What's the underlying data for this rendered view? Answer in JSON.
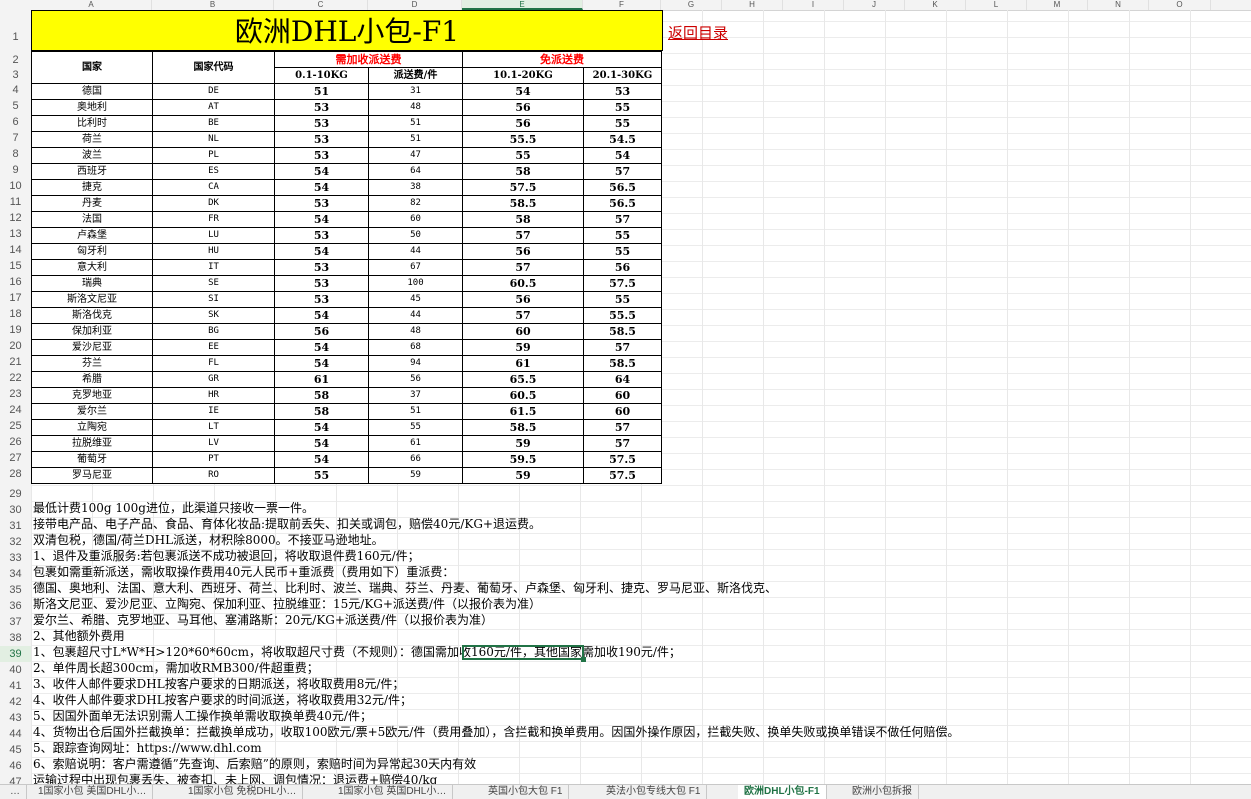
{
  "title": "欧洲DHL小包-F1",
  "back_link": "返回目录",
  "columns": [
    "A",
    "B",
    "C",
    "D",
    "E",
    "F",
    "G",
    "H",
    "I",
    "J",
    "K",
    "L",
    "M",
    "N",
    "O"
  ],
  "selected_column": "E",
  "selected_row": "39",
  "headers": {
    "country": "国家",
    "code": "国家代码",
    "group_extra": "需加收派送费",
    "group_free": "免派送费",
    "w1": "0.1-10KG",
    "w1fee": "派送费/件",
    "w2": "10.1-20KG",
    "w3": "20.1-30KG"
  },
  "rows": [
    {
      "country": "德国",
      "code": "DE",
      "w1": "51",
      "fee": "31",
      "w2": "54",
      "w3": "53"
    },
    {
      "country": "奥地利",
      "code": "AT",
      "w1": "53",
      "fee": "48",
      "w2": "56",
      "w3": "55"
    },
    {
      "country": "比利时",
      "code": "BE",
      "w1": "53",
      "fee": "51",
      "w2": "56",
      "w3": "55"
    },
    {
      "country": "荷兰",
      "code": "NL",
      "w1": "53",
      "fee": "51",
      "w2": "55.5",
      "w3": "54.5"
    },
    {
      "country": "波兰",
      "code": "PL",
      "w1": "53",
      "fee": "47",
      "w2": "55",
      "w3": "54"
    },
    {
      "country": "西班牙",
      "code": "ES",
      "w1": "54",
      "fee": "64",
      "w2": "58",
      "w3": "57"
    },
    {
      "country": "捷克",
      "code": "CA",
      "w1": "54",
      "fee": "38",
      "w2": "57.5",
      "w3": "56.5"
    },
    {
      "country": "丹麦",
      "code": "DK",
      "w1": "53",
      "fee": "82",
      "w2": "58.5",
      "w3": "56.5"
    },
    {
      "country": "法国",
      "code": "FR",
      "w1": "54",
      "fee": "60",
      "w2": "58",
      "w3": "57"
    },
    {
      "country": "卢森堡",
      "code": "LU",
      "w1": "53",
      "fee": "50",
      "w2": "57",
      "w3": "55"
    },
    {
      "country": "匈牙利",
      "code": "HU",
      "w1": "54",
      "fee": "44",
      "w2": "56",
      "w3": "55"
    },
    {
      "country": "意大利",
      "code": "IT",
      "w1": "53",
      "fee": "67",
      "w2": "57",
      "w3": "56"
    },
    {
      "country": "瑞典",
      "code": "SE",
      "w1": "53",
      "fee": "100",
      "w2": "60.5",
      "w3": "57.5"
    },
    {
      "country": "斯洛文尼亚",
      "code": "SI",
      "w1": "53",
      "fee": "45",
      "w2": "56",
      "w3": "55"
    },
    {
      "country": "斯洛伐克",
      "code": "SK",
      "w1": "54",
      "fee": "44",
      "w2": "57",
      "w3": "55.5"
    },
    {
      "country": "保加利亚",
      "code": "BG",
      "w1": "56",
      "fee": "48",
      "w2": "60",
      "w3": "58.5"
    },
    {
      "country": "爱沙尼亚",
      "code": "EE",
      "w1": "54",
      "fee": "68",
      "w2": "59",
      "w3": "57"
    },
    {
      "country": "芬兰",
      "code": "FL",
      "w1": "54",
      "fee": "94",
      "w2": "61",
      "w3": "58.5"
    },
    {
      "country": "希腊",
      "code": "GR",
      "w1": "61",
      "fee": "56",
      "w2": "65.5",
      "w3": "64"
    },
    {
      "country": "克罗地亚",
      "code": "HR",
      "w1": "58",
      "fee": "37",
      "w2": "60.5",
      "w3": "60"
    },
    {
      "country": "爱尔兰",
      "code": "IE",
      "w1": "58",
      "fee": "51",
      "w2": "61.5",
      "w3": "60"
    },
    {
      "country": "立陶宛",
      "code": "LT",
      "w1": "54",
      "fee": "55",
      "w2": "58.5",
      "w3": "57"
    },
    {
      "country": "拉脱维亚",
      "code": "LV",
      "w1": "54",
      "fee": "61",
      "w2": "59",
      "w3": "57"
    },
    {
      "country": "葡萄牙",
      "code": "PT",
      "w1": "54",
      "fee": "66",
      "w2": "59.5",
      "w3": "57.5"
    },
    {
      "country": "罗马尼亚",
      "code": "RO",
      "w1": "55",
      "fee": "59",
      "w2": "59",
      "w3": "57.5"
    }
  ],
  "notes": [
    {
      "row": "30",
      "text": "最低计费100g 100g进位，此渠道只接收一票一件。"
    },
    {
      "row": "31",
      "text": "接带电产品、电子产品、食品、育体化妆品:提取前丢失、扣关或调包，赔偿40元/KG+退运费。"
    },
    {
      "row": "32",
      "text": "双清包税，德国/荷兰DHL派送，材积除8000。不接亚马逊地址。"
    },
    {
      "row": "33",
      "text": "1、退件及重派服务:若包裹派送不成功被退回，将收取退件费160元/件；"
    },
    {
      "row": "34",
      "text": "包裹如需重新派送，需收取操作费用40元人民币+重派费（费用如下）重派费："
    },
    {
      "row": "35",
      "text": "德国、奥地利、法国、意大利、西班牙、荷兰、比利时、波兰、瑞典、芬兰、丹麦、葡萄牙、卢森堡、匈牙利、捷克、罗马尼亚、斯洛伐克、"
    },
    {
      "row": "36",
      "text": "斯洛文尼亚、爱沙尼亚、立陶宛、保加利亚、拉脱维亚：15元/KG+派送费/件（以报价表为准）"
    },
    {
      "row": "37",
      "text": "爱尔兰、希腊、克罗地亚、马耳他、塞浦路斯：20元/KG+派送费/件（以报价表为准）"
    },
    {
      "row": "38",
      "text": "2、其他额外费用"
    },
    {
      "row": "39",
      "text": "1、包裹超尺寸L*W*H>120*60*60cm，将收取超尺寸费（不规则）：德国需加收160元/件，其他国家需加收190元/件；"
    },
    {
      "row": "40",
      "text": "2、单件周长超300cm，需加收RMB300/件超重费；"
    },
    {
      "row": "41",
      "text": "3、收件人邮件要求DHL按客户要求的日期派送，将收取费用8元/件；"
    },
    {
      "row": "42",
      "text": "4、收件人邮件要求DHL按客户要求的时间派送，将收取费用32元/件；"
    },
    {
      "row": "43",
      "text": "5、因国外面单无法识别需人工操作换单需收取换单费40元/件；"
    },
    {
      "row": "44",
      "text": "4、货物出仓后国外拦截换单：拦截换单成功，收取100欧元/票+5欧元/件（费用叠加），含拦截和换单费用。因国外操作原因，拦截失败、换单失败或换单错误不做任何赔偿。"
    },
    {
      "row": "45",
      "text": "5、跟踪查询网址：https://www.dhl.com"
    },
    {
      "row": "46",
      "text": "6、索赔说明：客户需遵循”先查询、后索赔”的原则，索赔时间为异常起30天内有效"
    },
    {
      "row": "47",
      "text": "运输过程中出现包裹丢失、被查扣、未上网、调包情况：退运费+赔偿40/kg"
    }
  ],
  "sheet_tabs": [
    "…",
    "1国家小包 美国DHL小…",
    "1国家小包 免税DHL小…",
    "1国家小包 英国DHL小…",
    "英国小包大包 F1",
    "英法小包专线大包 F1",
    "欧洲DHL小包-F1",
    "欧洲小包拆报"
  ],
  "active_tab_index": 6
}
